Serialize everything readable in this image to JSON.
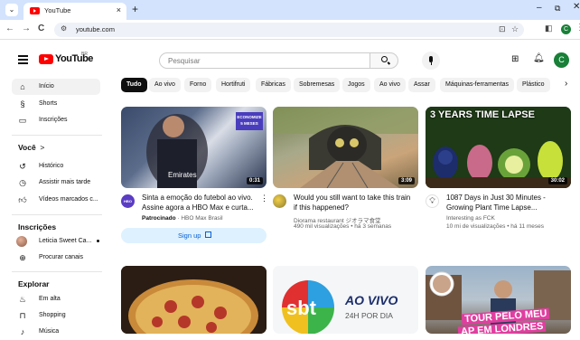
{
  "browser": {
    "tab_title": "YouTube",
    "tab_close": "×",
    "new_tab": "+",
    "url": "youtube.com",
    "nav_back": "←",
    "nav_forward": "→",
    "nav_reload": "C",
    "profile_initial": "C"
  },
  "header": {
    "logo_text": "YouTube",
    "logo_country": "BR",
    "search_placeholder": "Pesquisar",
    "avatar_initial": "C"
  },
  "sidebar": {
    "main": [
      {
        "label": "Início",
        "icon": "home-icon"
      },
      {
        "label": "Shorts",
        "icon": "shorts-icon"
      },
      {
        "label": "Inscrições",
        "icon": "subscriptions-icon"
      }
    ],
    "you_heading": "Você",
    "you_chevron": ">",
    "you": [
      {
        "label": "Histórico",
        "icon": "history-icon"
      },
      {
        "label": "Assistir mais tarde",
        "icon": "watch-later-icon"
      },
      {
        "label": "Vídeos marcados c...",
        "icon": "thumbs-up-icon"
      }
    ],
    "subs_heading": "Inscrições",
    "subs": [
      {
        "label": "Leticia Sweet Ca...",
        "icon": "channel-avatar"
      },
      {
        "label": "Procurar canais",
        "icon": "browse-channels-icon"
      }
    ],
    "explore_heading": "Explorar",
    "explore": [
      {
        "label": "Em alta",
        "icon": "trending-icon"
      },
      {
        "label": "Shopping",
        "icon": "shopping-icon"
      },
      {
        "label": "Música",
        "icon": "music-icon"
      }
    ]
  },
  "chips": [
    "Tudo",
    "Ao vivo",
    "Forno",
    "Hortifruti",
    "Fábricas",
    "Sobremesas",
    "Jogos",
    "Ao vivo",
    "Assar",
    "Máquinas-ferramentas",
    "Plástico"
  ],
  "videos": [
    {
      "title1": "Sinta a emoção do futebol ao vivo.",
      "title2": "Assine agora a HBO Max e curta...",
      "sponsored": "Patrocinado",
      "channel": " · HBO Max Brasil",
      "duration": "0:31",
      "badge_line1": "ECONOMIZE",
      "badge_line2": "5 MESES",
      "action": "Sign up"
    },
    {
      "title1": "Would you still want to take this train",
      "title2": "if this happened?",
      "channel": "Diorama restaurant ジオラマ食堂",
      "meta": "490 mil visualizações • há 3 semanas",
      "duration": "3:09"
    },
    {
      "title1": "1087 Days in Just 30 Minutes -",
      "title2": "Growing Plant Time Lapse...",
      "channel": "Interesting as FCK",
      "meta": "10 mi de visualizações • há 11 meses",
      "duration": "30:02",
      "thumb_text": "3 YEARS TIME LAPSE"
    },
    {
      "thumb_text": ""
    },
    {
      "thumb_text_logo": "sbt",
      "thumb_text1": "AO VIVO",
      "thumb_text2": "24H POR DIA"
    },
    {
      "thumb_text1": "TOUR PELO MEU",
      "thumb_text2": "AP EM LONDRES"
    }
  ],
  "colors": {
    "brand_red": "#ff0000",
    "link_blue": "#065fd4",
    "chip_active": "#0f0f0f"
  }
}
